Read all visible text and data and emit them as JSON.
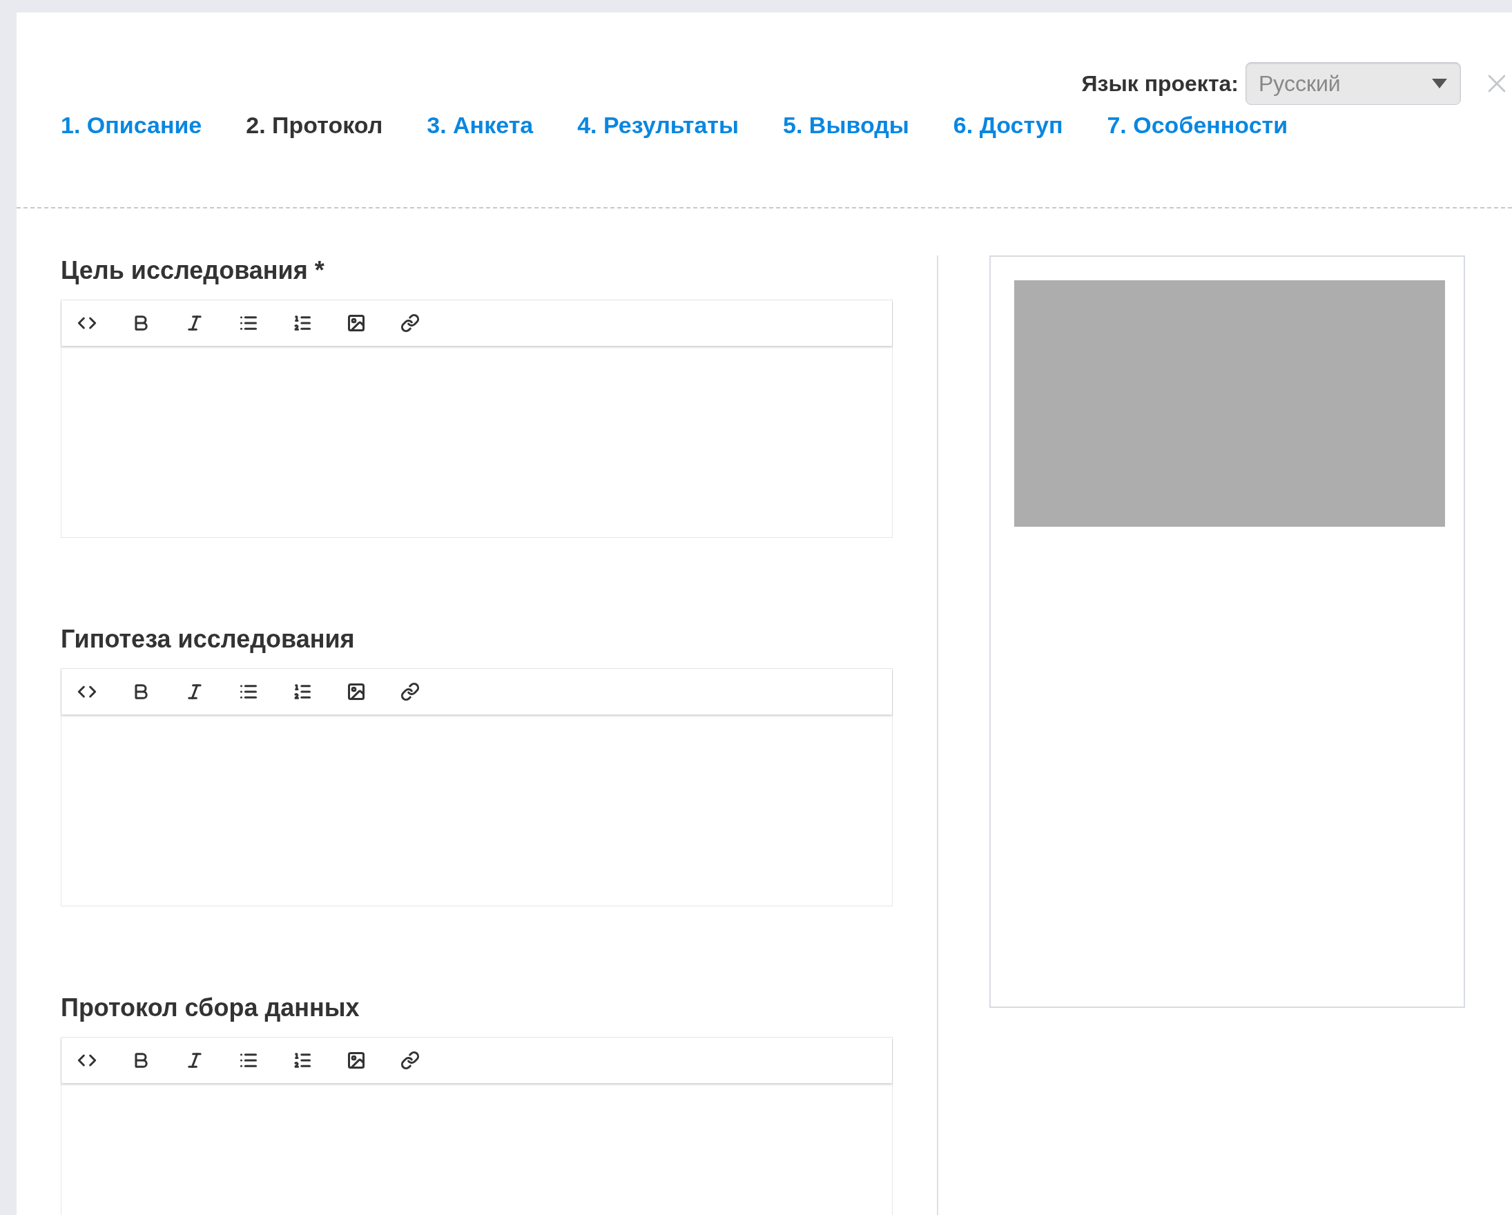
{
  "language": {
    "label": "Язык проекта:",
    "value": "Русский"
  },
  "tabs": [
    {
      "label": "1. Описание",
      "selected": false
    },
    {
      "label": "2. Протокол",
      "selected": true
    },
    {
      "label": "3. Анкета",
      "selected": false
    },
    {
      "label": "4. Результаты",
      "selected": false
    },
    {
      "label": "5. Выводы",
      "selected": false
    },
    {
      "label": "6. Доступ",
      "selected": false
    },
    {
      "label": "7. Особенности",
      "selected": false
    }
  ],
  "fields": [
    {
      "label": "Цель исследования *"
    },
    {
      "label": "Гипотеза исследования"
    },
    {
      "label": "Протокол сбора данных"
    }
  ]
}
